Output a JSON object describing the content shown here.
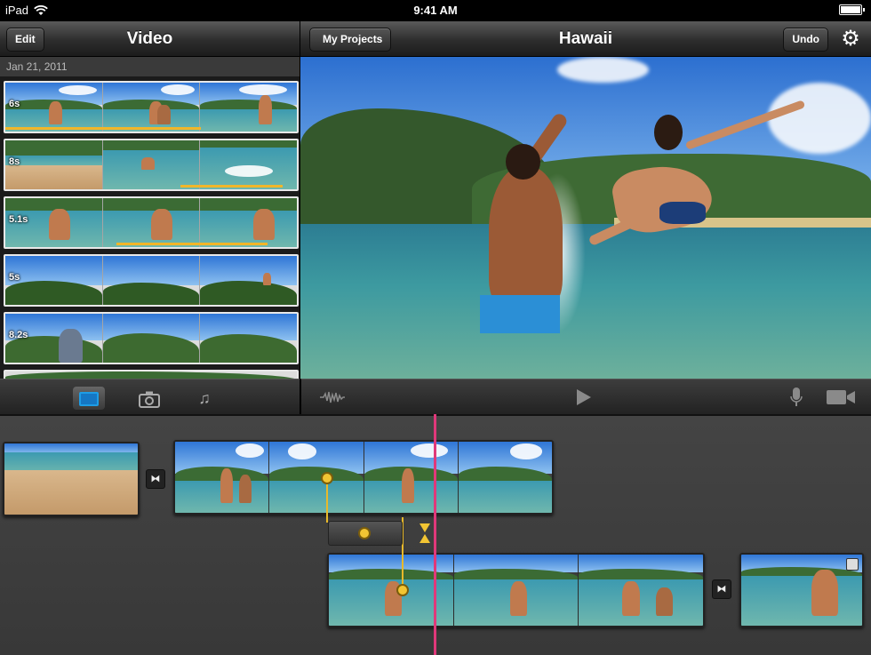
{
  "status_bar": {
    "device": "iPad",
    "time": "9:41 AM"
  },
  "browser": {
    "title": "Video",
    "edit_label": "Edit",
    "date": "Jan 21, 2011",
    "clips": [
      {
        "duration": "6s"
      },
      {
        "duration": "8s"
      },
      {
        "duration": "5.1s"
      },
      {
        "duration": "5s"
      },
      {
        "duration": "8.2s"
      }
    ],
    "tabs": [
      "video-tab",
      "photo-tab",
      "music-tab"
    ]
  },
  "project": {
    "title": "Hawaii",
    "back_label": "My Projects",
    "undo_label": "Undo"
  },
  "colors": {
    "playhead": "#e0387a",
    "trim_handle": "#f2c533",
    "used_marker": "#f1b62a",
    "selected_tab": "#1577c4"
  }
}
